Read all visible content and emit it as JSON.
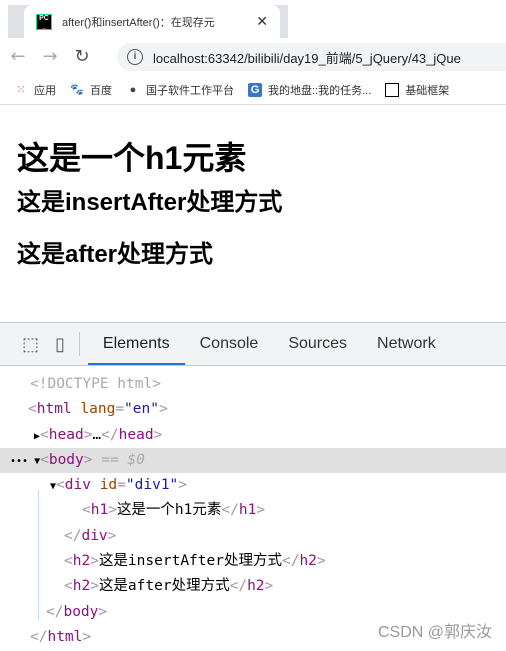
{
  "browser": {
    "tab_title": "after()和insertAfter()：在现存元",
    "url": "localhost:63342/bilibili/day19_前端/5_jQuery/43_jQue",
    "bookmarks": [
      "应用",
      "百度",
      "国子软件工作平台",
      "我的地盘::我的任务...",
      "基础框架"
    ]
  },
  "page": {
    "h1": "这是一个h1元素",
    "h2a": "这是insertAfter处理方式",
    "h2b": "这是after处理方式"
  },
  "devtools": {
    "tabs": [
      "Elements",
      "Console",
      "Sources",
      "Network"
    ],
    "doctype": "<!DOCTYPE html>",
    "body_marker": " == $0",
    "div_id": "\"div1\"",
    "lang": "\"en\"",
    "h1_text": "这是一个h1元素",
    "h2a_text": "这是insertAfter处理方式",
    "h2b_text": "这是after处理方式"
  },
  "watermark": "CSDN @郭庆汝"
}
